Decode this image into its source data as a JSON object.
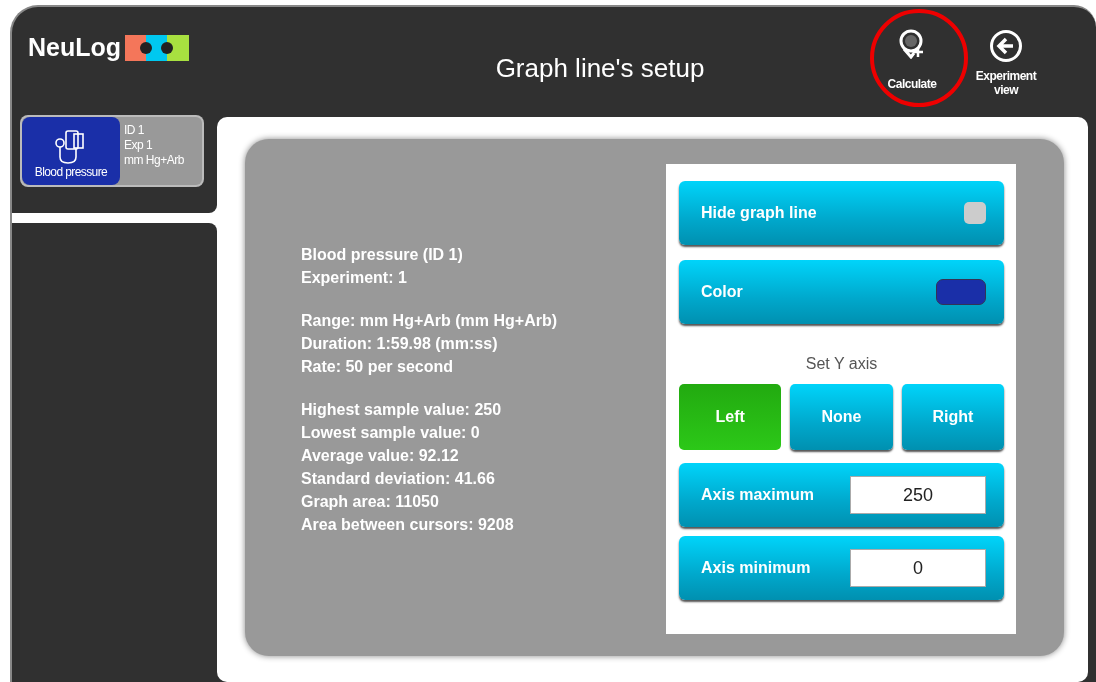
{
  "header": {
    "logo": "NeuLog",
    "title": "Graph line's setup",
    "toolbar": [
      {
        "kind": "calculate",
        "label": "Calculate",
        "highlighted": true
      },
      {
        "kind": "back",
        "label": "Experiment view",
        "highlighted": false
      }
    ]
  },
  "sensors": [
    {
      "name": "Blood pressure",
      "id": "ID 1",
      "experiment": "Exp 1",
      "unit": "mm Hg+Arb",
      "selected": true
    }
  ],
  "info": [
    [
      "Blood pressure (ID 1)",
      "Experiment: 1"
    ],
    [
      "Range: mm Hg+Arb (mm Hg+Arb)",
      "Duration: 1:59.98 (mm:ss)",
      "Rate: 50 per second"
    ],
    [
      "Highest sample value: 250",
      "Lowest sample value: 0",
      "Average value: 92.12",
      "Standard deviation: 41.66",
      "Graph area: 11050",
      "Area between cursors: 9208"
    ]
  ],
  "settings": {
    "hide_graph_line": {
      "label": "Hide graph line",
      "checked": false
    },
    "color": {
      "label": "Color",
      "color": "#1a2fa8"
    },
    "y_axis": {
      "label": "Set Y axis",
      "options": [
        {
          "label": "Left",
          "selected": true
        },
        {
          "label": "None",
          "selected": false
        },
        {
          "label": "Right",
          "selected": false
        }
      ]
    },
    "axis_maximum": {
      "label": "Axis maximum",
      "value": "250"
    },
    "axis_minimum": {
      "label": "Axis minimum",
      "value": "0"
    }
  }
}
